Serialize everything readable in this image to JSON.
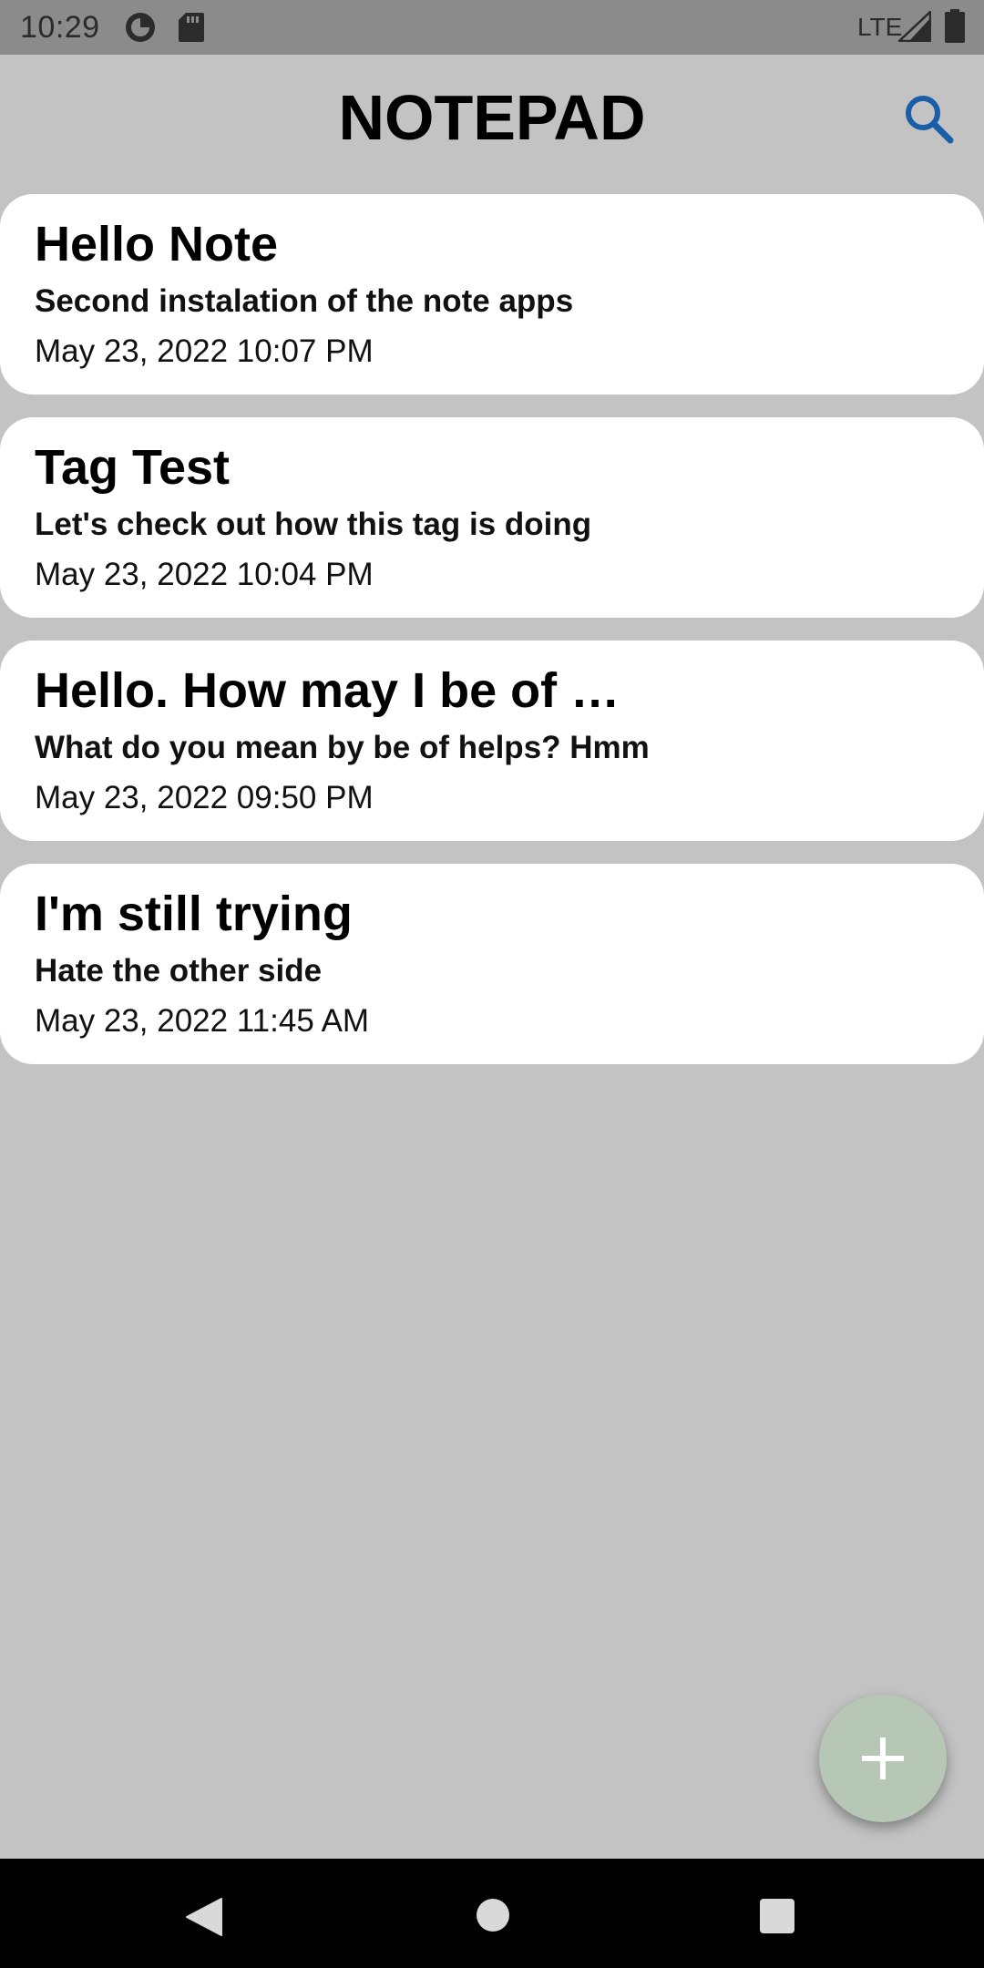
{
  "status_bar": {
    "time": "10:29",
    "network": "LTE",
    "icons": [
      "data-saver-icon",
      "sd-card-icon",
      "signal-icon",
      "battery-icon"
    ]
  },
  "app_bar": {
    "title": "NOTEPAD",
    "search_icon": "search-icon",
    "accent_color": "#1a5ea8"
  },
  "notes": [
    {
      "title": "Hello Note",
      "body": "Second instalation of the note apps",
      "date": "May 23, 2022 10:07 PM"
    },
    {
      "title": "Tag Test",
      "body": "Let's check out how this tag is doing",
      "date": "May 23, 2022 10:04 PM"
    },
    {
      "title": "Hello. How may I be of …",
      "body": "What do you mean by be of helps? Hmm",
      "date": "May 23, 2022 09:50 PM"
    },
    {
      "title": "I'm still trying",
      "body": "Hate the other side",
      "date": "May 23, 2022 11:45 AM"
    }
  ],
  "fab": {
    "icon": "plus-icon",
    "color": "#b6c7b5"
  },
  "nav_bar": {
    "icons": [
      "back-icon",
      "home-icon",
      "recents-icon"
    ]
  },
  "colors": {
    "background": "#c3c3c3",
    "card": "#ffffff",
    "status_bar": "#8b8b8b",
    "nav_bar": "#000000"
  }
}
